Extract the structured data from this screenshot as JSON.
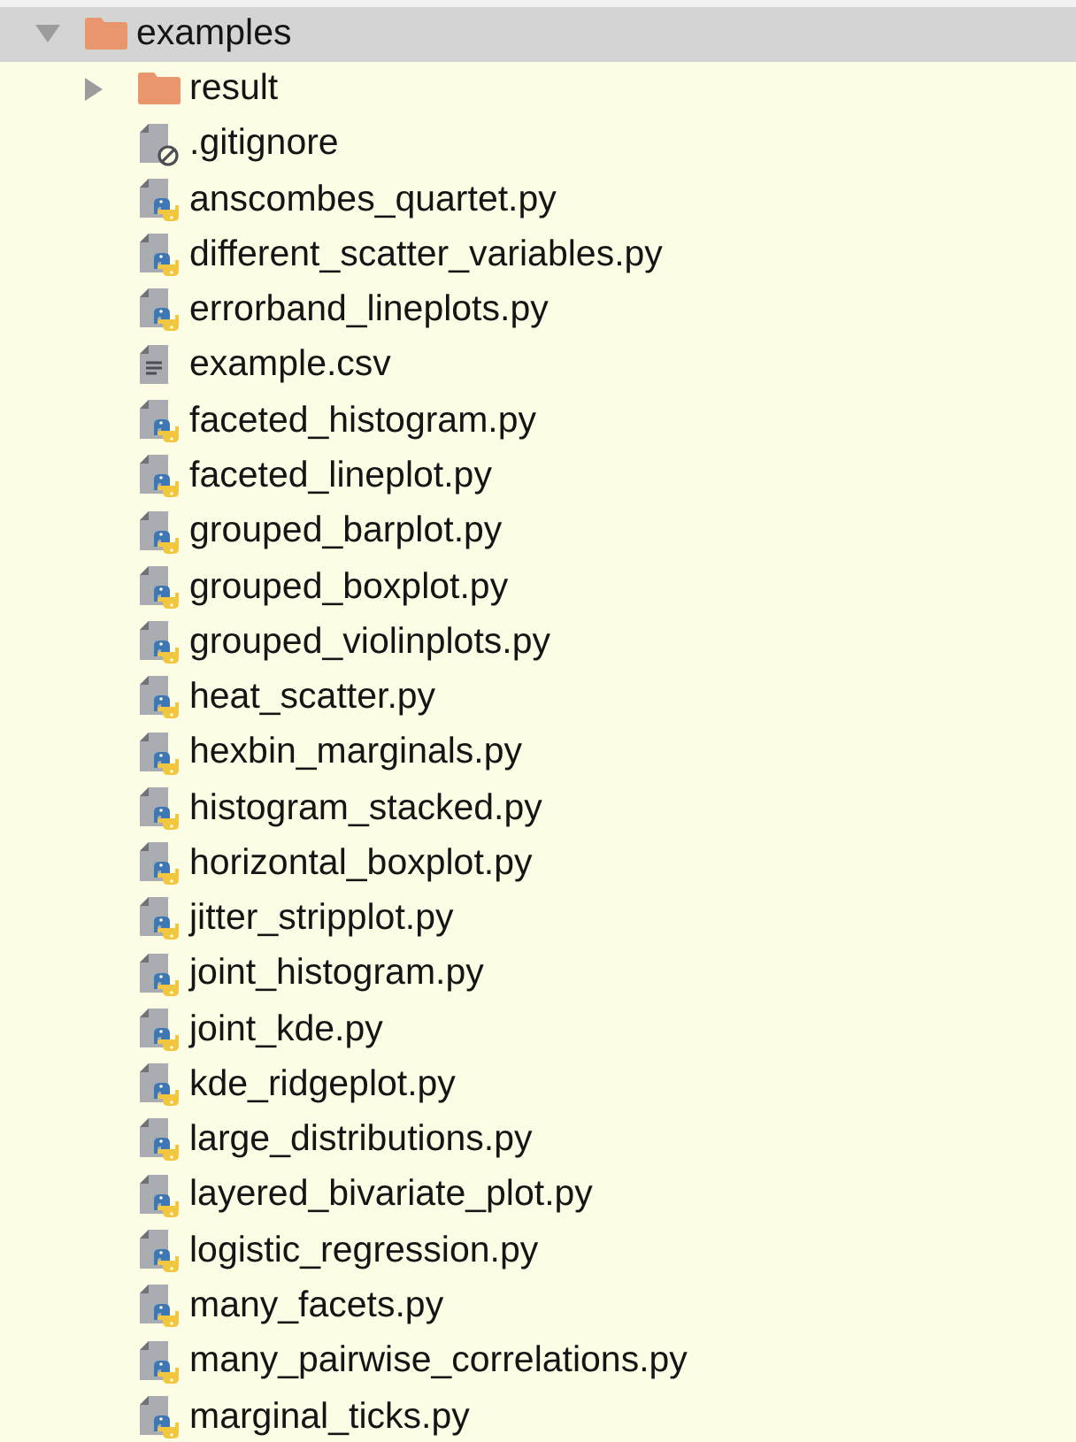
{
  "tree": {
    "label": "examples",
    "kind": "folder",
    "expanded": true,
    "selected": true,
    "children": [
      {
        "label": "result",
        "kind": "folder",
        "expanded": false,
        "selected": false
      },
      {
        "label": ".gitignore",
        "kind": "ignored",
        "selected": false
      },
      {
        "label": "anscombes_quartet.py",
        "kind": "python",
        "selected": false
      },
      {
        "label": "different_scatter_variables.py",
        "kind": "python",
        "selected": false
      },
      {
        "label": "errorband_lineplots.py",
        "kind": "python",
        "selected": false
      },
      {
        "label": "example.csv",
        "kind": "text",
        "selected": false
      },
      {
        "label": "faceted_histogram.py",
        "kind": "python",
        "selected": false
      },
      {
        "label": "faceted_lineplot.py",
        "kind": "python",
        "selected": false
      },
      {
        "label": "grouped_barplot.py",
        "kind": "python",
        "selected": false
      },
      {
        "label": "grouped_boxplot.py",
        "kind": "python",
        "selected": false
      },
      {
        "label": "grouped_violinplots.py",
        "kind": "python",
        "selected": false
      },
      {
        "label": "heat_scatter.py",
        "kind": "python",
        "selected": false
      },
      {
        "label": "hexbin_marginals.py",
        "kind": "python",
        "selected": false
      },
      {
        "label": "histogram_stacked.py",
        "kind": "python",
        "selected": false
      },
      {
        "label": "horizontal_boxplot.py",
        "kind": "python",
        "selected": false
      },
      {
        "label": "jitter_stripplot.py",
        "kind": "python",
        "selected": false
      },
      {
        "label": "joint_histogram.py",
        "kind": "python",
        "selected": false
      },
      {
        "label": "joint_kde.py",
        "kind": "python",
        "selected": false
      },
      {
        "label": "kde_ridgeplot.py",
        "kind": "python",
        "selected": false
      },
      {
        "label": "large_distributions.py",
        "kind": "python",
        "selected": false
      },
      {
        "label": "layered_bivariate_plot.py",
        "kind": "python",
        "selected": false
      },
      {
        "label": "logistic_regression.py",
        "kind": "python",
        "selected": false
      },
      {
        "label": "many_facets.py",
        "kind": "python",
        "selected": false
      },
      {
        "label": "many_pairwise_correlations.py",
        "kind": "python",
        "selected": false
      },
      {
        "label": "marginal_ticks.py",
        "kind": "python",
        "selected": false
      }
    ]
  }
}
